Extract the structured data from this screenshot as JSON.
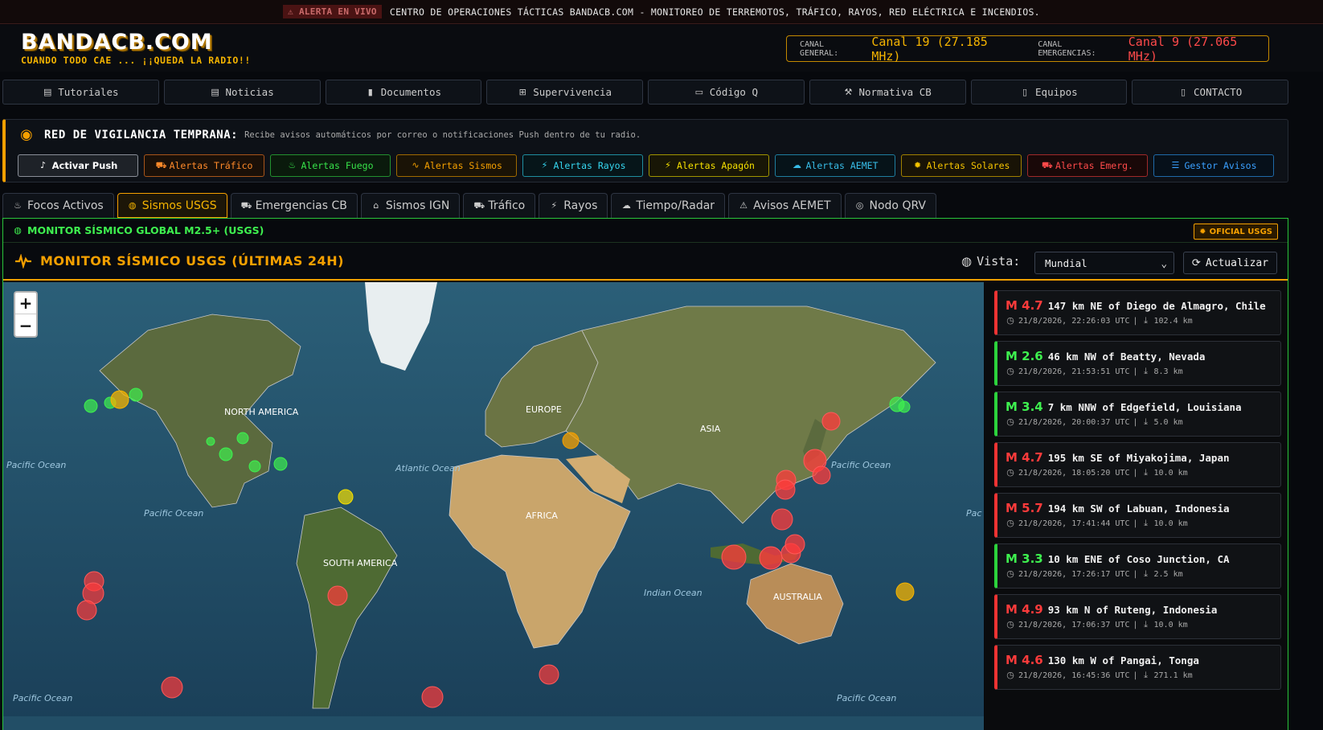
{
  "topbar": {
    "badge": "⚠ ALERTA EN VIVO",
    "text": "CENTRO DE OPERACIONES TÁCTICAS BANDACB.COM - MONITOREO DE TERREMOTOS, TRÁFICO, RAYOS, RED ELÉCTRICA E INCENDIOS."
  },
  "header": {
    "logo": "BANDACB.COM",
    "slogan": "CUANDO TODO CAE ... ¡¡QUEDA LA RADIO!!",
    "channel_general_label": "CANAL GENERAL:",
    "channel_general_value": "Canal 19 (27.185 MHz)",
    "channel_emergency_label": "CANAL EMERGENCIAS:",
    "channel_emergency_value": "Canal 9 (27.065 MHz)"
  },
  "nav": [
    {
      "label": "Tutoriales",
      "icon": "book-icon"
    },
    {
      "label": "Noticias",
      "icon": "newspaper-icon"
    },
    {
      "label": "Documentos",
      "icon": "file-icon"
    },
    {
      "label": "Supervivencia",
      "icon": "kit-icon"
    },
    {
      "label": "Código Q",
      "icon": "id-card-icon"
    },
    {
      "label": "Normativa CB",
      "icon": "gavel-icon"
    },
    {
      "label": "Equipos",
      "icon": "radio-icon"
    },
    {
      "label": "CONTACTO",
      "icon": "radio-icon"
    }
  ],
  "alerts": {
    "title": "RED DE VIGILANCIA TEMPRANA:",
    "description": "Recibe avisos automáticos por correo o notificaciones Push dentro de tu radio.",
    "buttons": [
      {
        "label": "Activar Push",
        "icon": "bell-icon",
        "color": "#ffffff",
        "border": "#8a8f98",
        "bg": "#1e2228"
      },
      {
        "label": "Alertas Tráfico",
        "icon": "car-icon",
        "color": "#ff8a2a",
        "border": "#a8551a",
        "bg": "#1a1008"
      },
      {
        "label": "Alertas Fuego",
        "icon": "fire-icon",
        "color": "#37e24a",
        "border": "#23912f",
        "bg": "#0a1a0c"
      },
      {
        "label": "Alertas Sismos",
        "icon": "pulse-icon",
        "color": "#f5a000",
        "border": "#a06a00",
        "bg": "#1a1306"
      },
      {
        "label": "Alertas Rayos",
        "icon": "bolt-icon",
        "color": "#36d7f0",
        "border": "#1f8ea0",
        "bg": "#061519"
      },
      {
        "label": "Alertas Apagón",
        "icon": "bolt-icon",
        "color": "#f5e000",
        "border": "#a09400",
        "bg": "#181606"
      },
      {
        "label": "Alertas AEMET",
        "icon": "cloud-icon",
        "color": "#38bde8",
        "border": "#1f7ea0",
        "bg": "#061319"
      },
      {
        "label": "Alertas Solares",
        "icon": "sun-icon",
        "color": "#f5c400",
        "border": "#a08000",
        "bg": "#181306"
      },
      {
        "label": "Alertas Emerg.",
        "icon": "ambulance-icon",
        "color": "#ff4a4a",
        "border": "#a02a2a",
        "bg": "#190808"
      },
      {
        "label": "Gestor Avisos",
        "icon": "sliders-icon",
        "color": "#3aa0ff",
        "border": "#1f6aa8",
        "bg": "#06101a"
      }
    ]
  },
  "tabs": [
    {
      "label": "Focos Activos",
      "icon": "fire-icon"
    },
    {
      "label": "Sismos USGS",
      "icon": "globe-icon",
      "active": true
    },
    {
      "label": "Emergencias CB",
      "icon": "truck-icon"
    },
    {
      "label": "Sismos IGN",
      "icon": "building-icon"
    },
    {
      "label": "Tráfico",
      "icon": "car-icon"
    },
    {
      "label": "Rayos",
      "icon": "bolt-icon"
    },
    {
      "label": "Tiempo/Radar",
      "icon": "cloud-icon"
    },
    {
      "label": "Avisos AEMET",
      "icon": "warning-icon"
    },
    {
      "label": "Nodo QRV",
      "icon": "target-icon"
    }
  ],
  "monitor": {
    "header": "MONITOR SÍSMICO GLOBAL M2.5+ (USGS)",
    "badge": "OFICIAL USGS",
    "subtitle": "MONITOR SÍSMICO USGS (ÚLTIMAS 24H)",
    "view_label": "Vista:",
    "view_value": "Mundial",
    "refresh_label": "Actualizar"
  },
  "map": {
    "labels": {
      "na": "NORTH AMERICA",
      "eu": "EUROPE",
      "as": "ASIA",
      "af": "AFRICA",
      "sa": "SOUTH AMERICA",
      "au": "AUSTRALIA",
      "atl": "Atlantic Ocean",
      "ind": "Indian Ocean",
      "pac1": "Pacific Ocean",
      "pac2": "Pacific Ocean",
      "pac3": "Pacific Ocean",
      "pac4": "Pacific Ocean",
      "pac5": "Pacific Ocean",
      "pac6": "Pac"
    },
    "zoom_in": "+",
    "zoom_out": "−"
  },
  "earthquakes": [
    {
      "mag": "M 4.7",
      "place": "147 km NE of Diego de Almagro, Chile",
      "time": "21/8/2026, 22:26:03 UTC",
      "depth": "102.4 km",
      "level": "red"
    },
    {
      "mag": "M 2.6",
      "place": "46 km NW of Beatty, Nevada",
      "time": "21/8/2026, 21:53:51 UTC",
      "depth": "8.3 km",
      "level": "green"
    },
    {
      "mag": "M 3.4",
      "place": "7 km NNW of Edgefield, Louisiana",
      "time": "21/8/2026, 20:00:37 UTC",
      "depth": "5.0 km",
      "level": "green"
    },
    {
      "mag": "M 4.7",
      "place": "195 km SE of Miyakojima, Japan",
      "time": "21/8/2026, 18:05:20 UTC",
      "depth": "10.0 km",
      "level": "red"
    },
    {
      "mag": "M 5.7",
      "place": "194 km SW of Labuan, Indonesia",
      "time": "21/8/2026, 17:41:44 UTC",
      "depth": "10.0 km",
      "level": "red"
    },
    {
      "mag": "M 3.3",
      "place": "10 km ENE of Coso Junction, CA",
      "time": "21/8/2026, 17:26:17 UTC",
      "depth": "2.5 km",
      "level": "green"
    },
    {
      "mag": "M 4.9",
      "place": "93 km N of Ruteng, Indonesia",
      "time": "21/8/2026, 17:06:37 UTC",
      "depth": "10.0 km",
      "level": "red"
    },
    {
      "mag": "M 4.6",
      "place": "130 km W of Pangai, Tonga",
      "time": "21/8/2026, 16:45:36 UTC",
      "depth": "271.1 km",
      "level": "red"
    }
  ]
}
